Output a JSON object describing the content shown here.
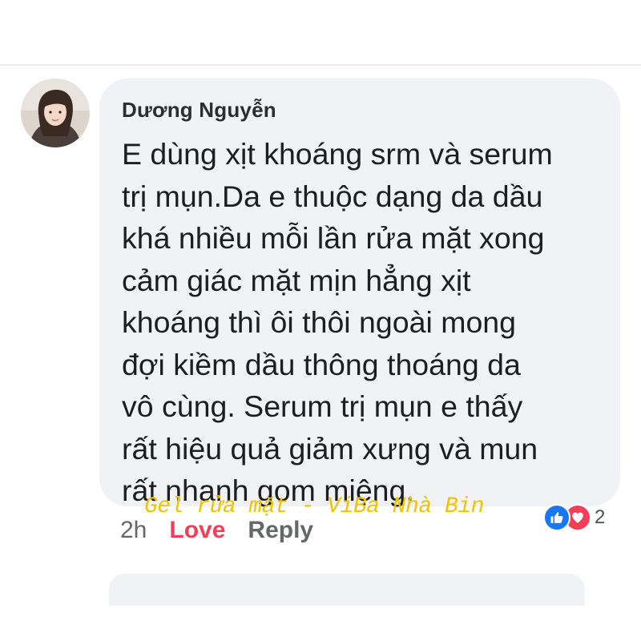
{
  "comment": {
    "author": "Dương Nguyễn",
    "text": "E dùng xịt khoáng srm và serum\ntrị mụn.Da e thuộc dạng da dầu\nkhá nhiều mỗi lần rửa mặt xong\ncảm giác mặt mịn hẳng xịt\nkhoáng thì ôi thôi ngoài mong\nđợi kiềm dầu thông thoáng da\nvô cùng. Serum trị mụn e thấy\nrất hiệu quả giảm xưng và mun\nrất nhanh gom miệng.",
    "time": "2h",
    "love_label": "Love",
    "reply_label": "Reply",
    "reactions": {
      "icons": [
        "like-icon",
        "heart-icon"
      ],
      "count": "2"
    }
  },
  "watermark": "Gel rửa mặt - ViBa Nhà Bin",
  "colors": {
    "bubble": "#f0f2f5",
    "love": "#f33e58",
    "like": "#1877f2",
    "watermark": "#f0c400",
    "muted": "#65676b"
  }
}
